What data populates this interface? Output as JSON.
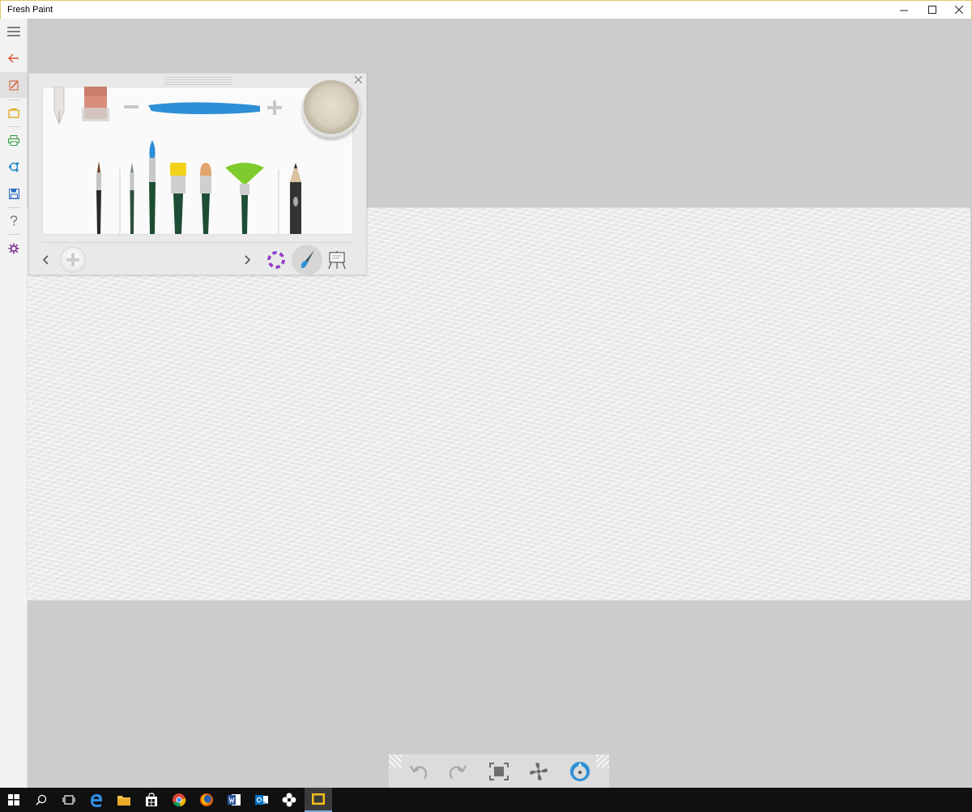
{
  "window": {
    "title": "Fresh Paint",
    "controls": [
      "minimize-icon",
      "maximize-icon",
      "close-icon"
    ]
  },
  "sidebar": {
    "items": [
      {
        "icon": "hamburger-menu-icon",
        "color": "#555555"
      },
      {
        "icon": "back-arrow-icon",
        "color": "#d8532e"
      },
      {
        "icon": "canvas-brush-icon",
        "color": "#d8532e",
        "active": true
      },
      {
        "icon": "new-canvas-icon",
        "color": "#e0a000"
      },
      {
        "icon": "print-icon",
        "color": "#2e9a3c"
      },
      {
        "icon": "share-icon",
        "color": "#1e88c8"
      },
      {
        "icon": "save-icon",
        "color": "#2b6cc4"
      },
      {
        "icon": "help-icon",
        "color": "#666666"
      },
      {
        "icon": "settings-icon",
        "color": "#7a2a8c"
      }
    ]
  },
  "palette": {
    "tools": [
      "pen-tool-icon",
      "eraser-tool-icon",
      "brush-size-decrease-icon",
      "brush-size-stroke-icon",
      "brush-size-increase-icon",
      "paint-pot-icon"
    ],
    "brushes": [
      "round-brush-icon",
      "liner-brush-icon",
      "pointed-brush-icon",
      "flat-brush-icon",
      "filbert-brush-icon",
      "fan-brush-icon",
      "pencil-icon"
    ],
    "selected_color": "#d6cfbc",
    "stroke_color": "#2f8fd6",
    "footer": [
      "prev-arrow-icon",
      "add-brush-icon",
      "next-arrow-icon",
      "color-wheel-icon",
      "brush-mode-icon",
      "easel-icon"
    ]
  },
  "bottom_toolbar": {
    "buttons": [
      "undo-icon",
      "redo-icon",
      "fit-screen-icon",
      "dry-fan-icon",
      "navigator-icon"
    ]
  },
  "taskbar": {
    "items": [
      "start-icon",
      "search-icon",
      "task-view-icon",
      "edge-icon",
      "file-explorer-icon",
      "store-icon",
      "chrome-icon",
      "firefox-icon",
      "word-icon",
      "outlook-icon",
      "app-icon",
      "fresh-paint-icon"
    ]
  }
}
